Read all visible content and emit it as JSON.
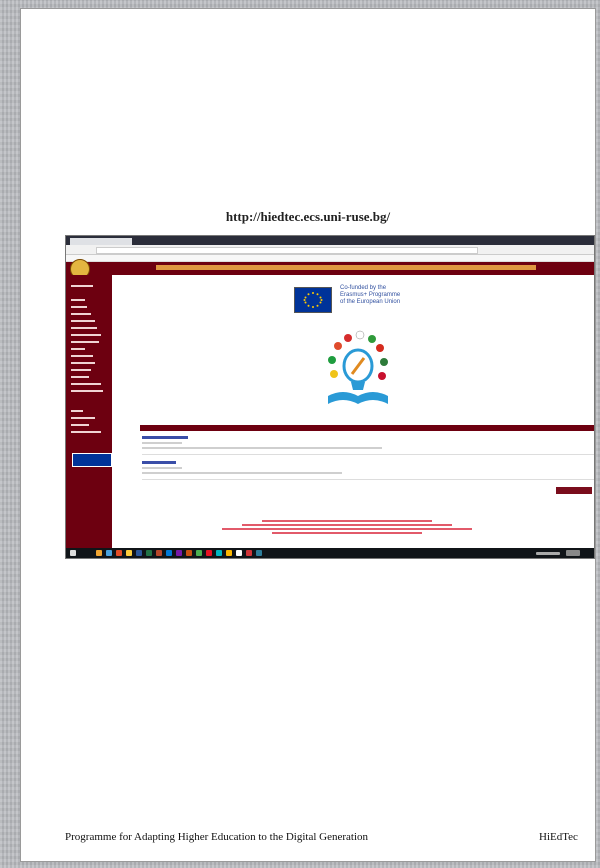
{
  "page": {
    "url": "http://hiedtec.ecs.uni-ruse.bg/",
    "footer_left": "Programme for Adapting Higher Education to the Digital Generation",
    "footer_right": "HiEdTec"
  },
  "embedded_screenshot": {
    "eu_text_lines": [
      "Co-funded by the",
      "Erasmus+ Programme",
      "of the European Union"
    ]
  },
  "colors": {
    "site_maroon": "#6d0010",
    "title_gold": "#f3b24a",
    "eu_blue": "#003399"
  }
}
